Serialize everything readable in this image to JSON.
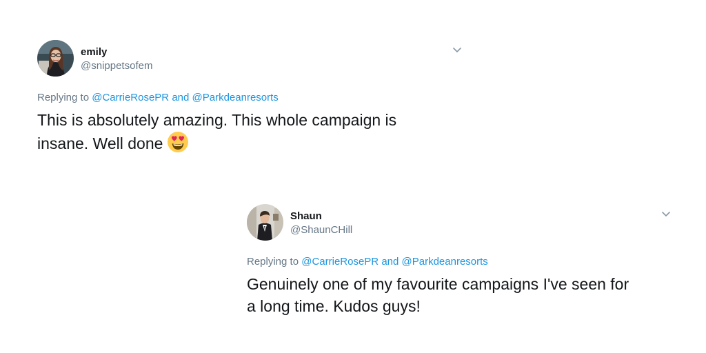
{
  "tweets": [
    {
      "display_name": "emily",
      "handle": "@snippetsofem",
      "replying_prefix": "Replying to",
      "mention_1": "@CarrieRosePR",
      "conjunction": "and",
      "mention_2": "@Parkdeanresorts",
      "text_line_1": "This is absolutely amazing. This whole campaign is",
      "text_line_2": "insane. Well done",
      "emoji": "smiling-face-with-heart-eyes",
      "avatar_icon": "avatar-woman-glasses-icon"
    },
    {
      "display_name": "Shaun",
      "handle": "@ShaunCHill",
      "replying_prefix": "Replying to",
      "mention_1": "@CarrieRosePR",
      "conjunction": "and",
      "mention_2": "@Parkdeanresorts",
      "text_line_1": "Genuinely one of my favourite campaigns I've seen for",
      "text_line_2": "a long time. Kudos guys!",
      "avatar_icon": "avatar-man-suit-icon"
    }
  ],
  "colors": {
    "text": "#14171a",
    "secondary": "#657786",
    "link": "#1b95e0",
    "background": "#ffffff"
  }
}
